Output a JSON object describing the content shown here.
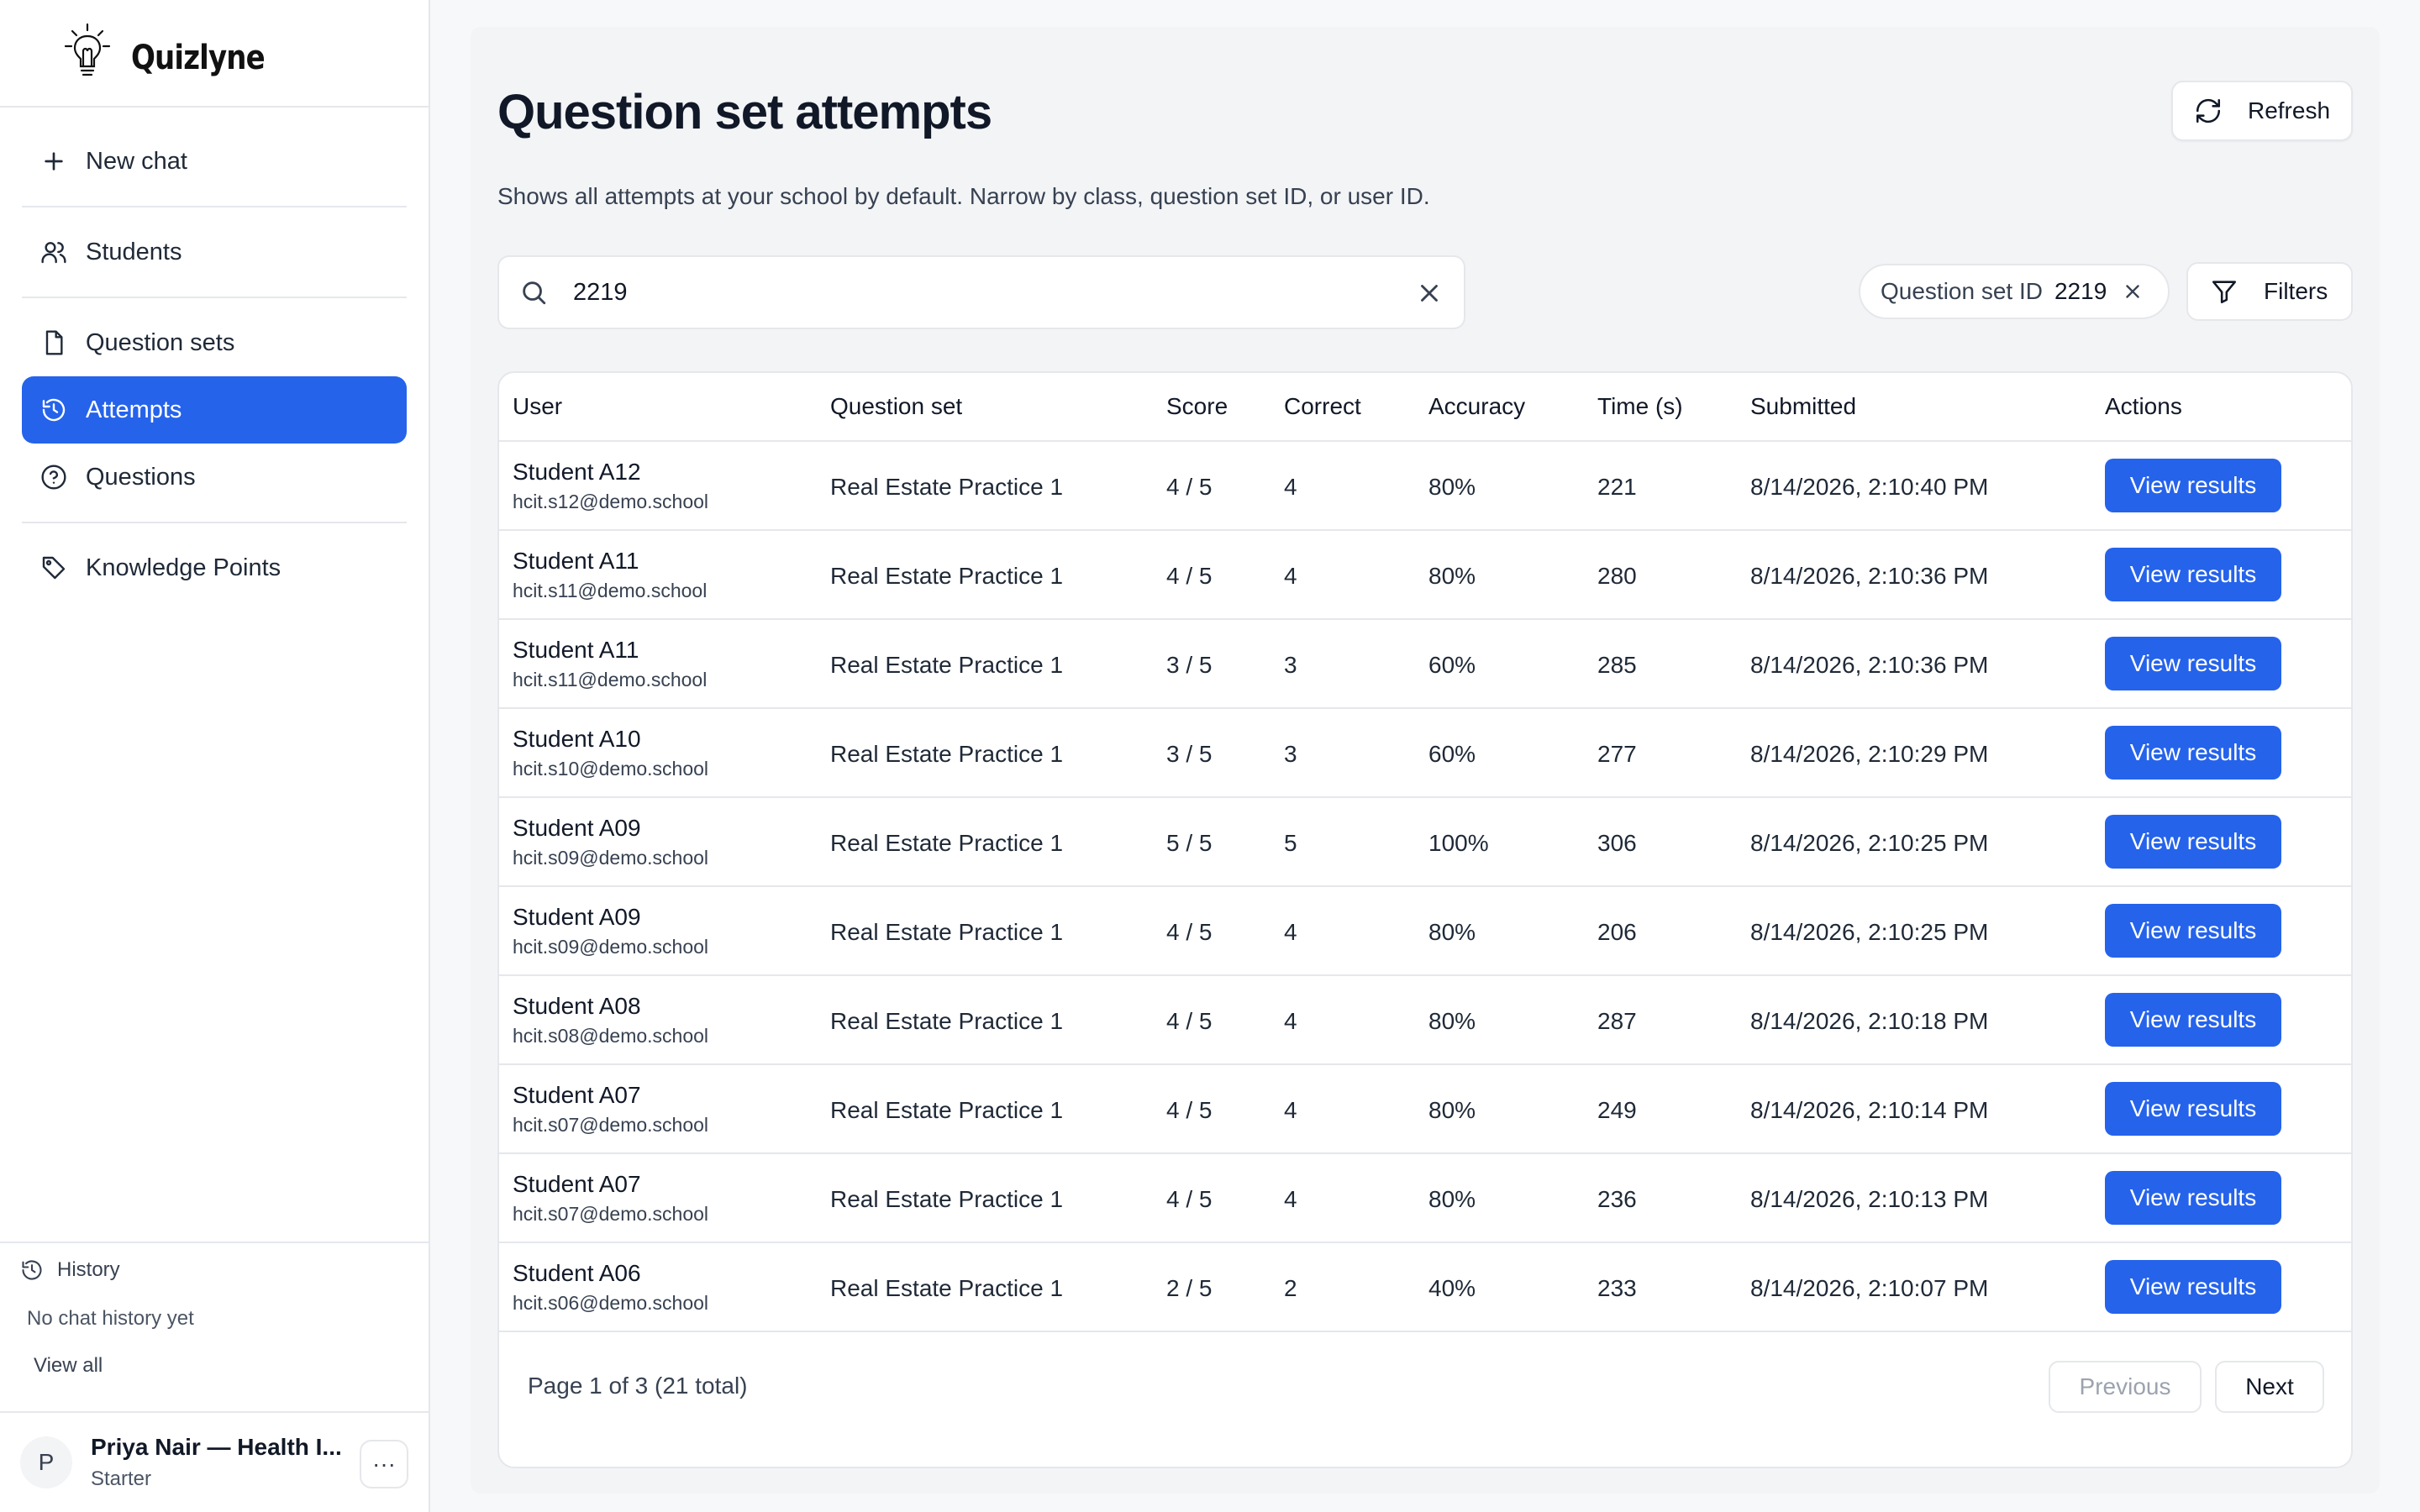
{
  "app": {
    "name": "Quizlyne"
  },
  "sidebar": {
    "items": [
      {
        "label": "New chat",
        "icon": "plus-icon"
      },
      {
        "label": "Students",
        "icon": "users-icon"
      },
      {
        "label": "Question sets",
        "icon": "document-icon"
      },
      {
        "label": "Attempts",
        "icon": "history-icon",
        "active": true
      },
      {
        "label": "Questions",
        "icon": "help-circle-icon"
      },
      {
        "label": "Knowledge Points",
        "icon": "tag-icon"
      }
    ],
    "history": {
      "title": "History",
      "empty": "No chat history yet",
      "view_all": "View all"
    },
    "user": {
      "initial": "P",
      "name": "Priya Nair — Health I...",
      "plan": "Starter",
      "more": "···"
    }
  },
  "main": {
    "title": "Question set attempts",
    "refresh_label": "Refresh",
    "subtitle": "Shows all attempts at your school by default. Narrow by class, question set ID, or user ID.",
    "search_value": "2219",
    "filter_chip": {
      "label": "Question set ID",
      "value": "2219"
    },
    "filters_label": "Filters",
    "table": {
      "headers": [
        "User",
        "Question set",
        "Score",
        "Correct",
        "Accuracy",
        "Time (s)",
        "Submitted",
        "Actions"
      ],
      "action_label": "View results",
      "rows": [
        {
          "name": "Student A12",
          "email": "hcit.s12@demo.school",
          "set": "Real Estate Practice 1",
          "score": "4 / 5",
          "correct": "4",
          "accuracy": "80%",
          "time": "221",
          "submitted": "8/14/2026, 2:10:40 PM"
        },
        {
          "name": "Student A11",
          "email": "hcit.s11@demo.school",
          "set": "Real Estate Practice 1",
          "score": "4 / 5",
          "correct": "4",
          "accuracy": "80%",
          "time": "280",
          "submitted": "8/14/2026, 2:10:36 PM"
        },
        {
          "name": "Student A11",
          "email": "hcit.s11@demo.school",
          "set": "Real Estate Practice 1",
          "score": "3 / 5",
          "correct": "3",
          "accuracy": "60%",
          "time": "285",
          "submitted": "8/14/2026, 2:10:36 PM"
        },
        {
          "name": "Student A10",
          "email": "hcit.s10@demo.school",
          "set": "Real Estate Practice 1",
          "score": "3 / 5",
          "correct": "3",
          "accuracy": "60%",
          "time": "277",
          "submitted": "8/14/2026, 2:10:29 PM"
        },
        {
          "name": "Student A09",
          "email": "hcit.s09@demo.school",
          "set": "Real Estate Practice 1",
          "score": "5 / 5",
          "correct": "5",
          "accuracy": "100%",
          "time": "306",
          "submitted": "8/14/2026, 2:10:25 PM"
        },
        {
          "name": "Student A09",
          "email": "hcit.s09@demo.school",
          "set": "Real Estate Practice 1",
          "score": "4 / 5",
          "correct": "4",
          "accuracy": "80%",
          "time": "206",
          "submitted": "8/14/2026, 2:10:25 PM"
        },
        {
          "name": "Student A08",
          "email": "hcit.s08@demo.school",
          "set": "Real Estate Practice 1",
          "score": "4 / 5",
          "correct": "4",
          "accuracy": "80%",
          "time": "287",
          "submitted": "8/14/2026, 2:10:18 PM"
        },
        {
          "name": "Student A07",
          "email": "hcit.s07@demo.school",
          "set": "Real Estate Practice 1",
          "score": "4 / 5",
          "correct": "4",
          "accuracy": "80%",
          "time": "249",
          "submitted": "8/14/2026, 2:10:14 PM"
        },
        {
          "name": "Student A07",
          "email": "hcit.s07@demo.school",
          "set": "Real Estate Practice 1",
          "score": "4 / 5",
          "correct": "4",
          "accuracy": "80%",
          "time": "236",
          "submitted": "8/14/2026, 2:10:13 PM"
        },
        {
          "name": "Student A06",
          "email": "hcit.s06@demo.school",
          "set": "Real Estate Practice 1",
          "score": "2 / 5",
          "correct": "2",
          "accuracy": "40%",
          "time": "233",
          "submitted": "8/14/2026, 2:10:07 PM"
        }
      ]
    },
    "pagination": {
      "info": "Page 1 of 3 (21 total)",
      "previous": "Previous",
      "next": "Next"
    }
  },
  "colors": {
    "accent": "#2563eb",
    "border": "#e5e7eb",
    "background": "#f3f4f6"
  }
}
